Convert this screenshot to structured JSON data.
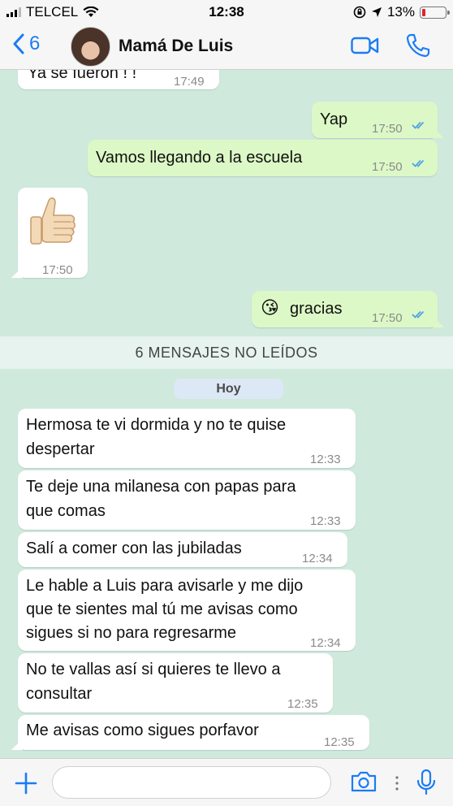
{
  "status_bar": {
    "carrier": "TELCEL",
    "time": "12:38",
    "battery": "13%"
  },
  "header": {
    "back_count": "6",
    "contact_name": "Mamá De Luis"
  },
  "messages_top": [
    {
      "text": "Ya se fueron ! !",
      "time": "17:49"
    },
    {
      "text": "Yap",
      "time": "17:50"
    },
    {
      "text": "Vamos llegando a la escuela",
      "time": "17:50"
    },
    {
      "text": "👍",
      "time": "17:50"
    },
    {
      "text": "gracias",
      "emoji": "😘",
      "time": "17:50"
    }
  ],
  "unread_banner": "6 MENSAJES NO LEÍDOS",
  "day_label": "Hoy",
  "messages_unread": [
    {
      "text_lines": [
        "Hermosa te vi dormida y no te quise",
        "despertar"
      ],
      "time": "12:33"
    },
    {
      "text_lines": [
        "Te deje una milanesa con papas para",
        "que comas"
      ],
      "time": "12:33"
    },
    {
      "text_lines": [
        "Salí a comer con las jubiladas"
      ],
      "time": "12:34"
    },
    {
      "text_lines": [
        "Le hable a Luis para avisarle y me dijo",
        "que te sientes mal tú me avisas como",
        "sigues si no para regresarme"
      ],
      "time": "12:34"
    },
    {
      "text_lines": [
        "No te vallas así si quieres te llevo a",
        "consultar"
      ],
      "time": "12:35"
    },
    {
      "text_lines": [
        "Me avisas como sigues porfavor"
      ],
      "time": "12:35"
    }
  ],
  "input": {
    "value": "",
    "placeholder": ""
  },
  "icons": {
    "back": "chevron-left-icon",
    "video": "video-camera-icon",
    "phone": "phone-icon",
    "plus": "plus-icon",
    "camera": "camera-icon",
    "mic": "microphone-icon",
    "ticks": "double-check-icon"
  },
  "colors": {
    "accent": "#1a7cf5",
    "chat_bg": "#cfe9dd",
    "outgoing": "#dcf8c6",
    "incoming": "#ffffff",
    "ticks": "#4fa3e0"
  }
}
